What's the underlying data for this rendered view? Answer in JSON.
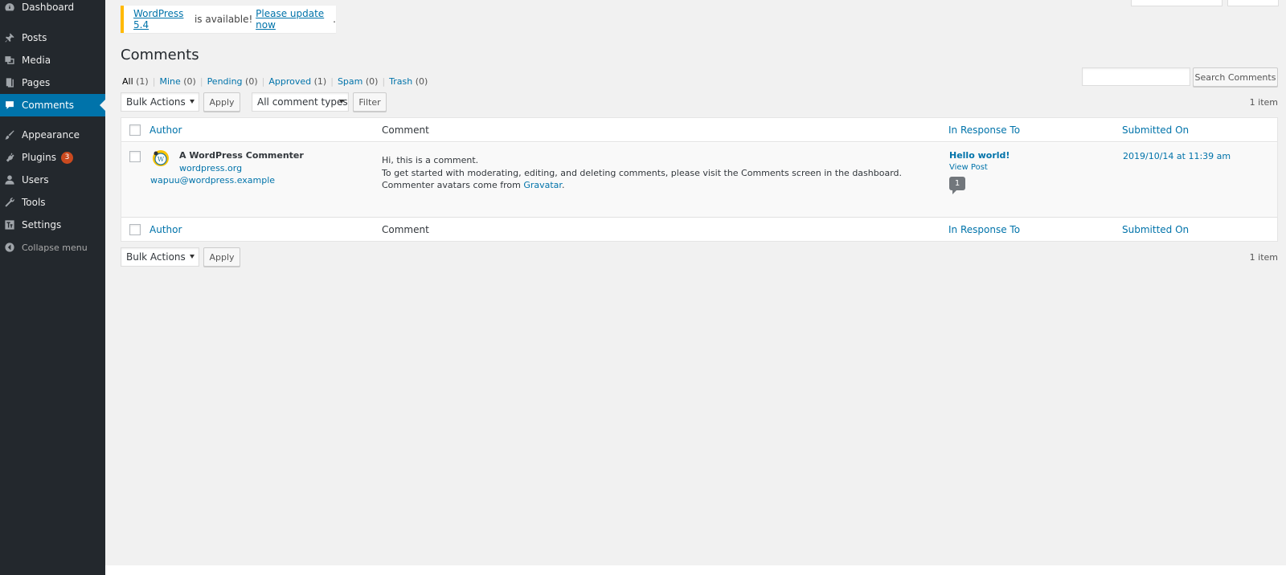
{
  "sidebar": {
    "items": [
      {
        "label": "Dashboard",
        "icon": "dashboard-icon"
      },
      {
        "label": "Posts",
        "icon": "pin-icon"
      },
      {
        "label": "Media",
        "icon": "media-icon"
      },
      {
        "label": "Pages",
        "icon": "pages-icon"
      },
      {
        "label": "Comments",
        "icon": "comment-icon"
      },
      {
        "label": "Appearance",
        "icon": "brush-icon"
      },
      {
        "label": "Plugins",
        "icon": "plug-icon",
        "badge": "3"
      },
      {
        "label": "Users",
        "icon": "user-icon"
      },
      {
        "label": "Tools",
        "icon": "wrench-icon"
      },
      {
        "label": "Settings",
        "icon": "settings-icon"
      },
      {
        "label": "Collapse menu",
        "icon": "collapse-icon"
      }
    ],
    "current": "Comments"
  },
  "notice": {
    "link1": "WordPress 5.4",
    "text": " is available! ",
    "link2": "Please update now",
    "end": "."
  },
  "page_title": "Comments",
  "filters": [
    {
      "label": "All",
      "count": "(1)"
    },
    {
      "label": "Mine",
      "count": "(0)"
    },
    {
      "label": "Pending",
      "count": "(0)"
    },
    {
      "label": "Approved",
      "count": "(1)"
    },
    {
      "label": "Spam",
      "count": "(0)"
    },
    {
      "label": "Trash",
      "count": "(0)"
    }
  ],
  "sep": "|",
  "toolbar": {
    "bulk_actions": "Bulk Actions",
    "apply": "Apply",
    "comment_types": "All comment types",
    "filter": "Filter",
    "search_button": "Search Comments",
    "items_count": "1 item"
  },
  "table": {
    "columns": [
      "Author",
      "Comment",
      "In Response To",
      "Submitted On"
    ],
    "row": {
      "author_name": "A WordPress Commenter",
      "author_url": "wordpress.org",
      "author_email": "wapuu@wordpress.example",
      "comment_lines": [
        "Hi, this is a comment.",
        "To get started with moderating, editing, and deleting comments, please visit the Comments screen in the dashboard."
      ],
      "comment_line3_prefix": "Commenter avatars come from ",
      "comment_line3_link": "Gravatar",
      "comment_line3_suffix": ".",
      "response_title": "Hello world!",
      "response_view": "View Post",
      "response_count": "1",
      "submitted": "2019/10/14 at 11:39 am"
    }
  }
}
